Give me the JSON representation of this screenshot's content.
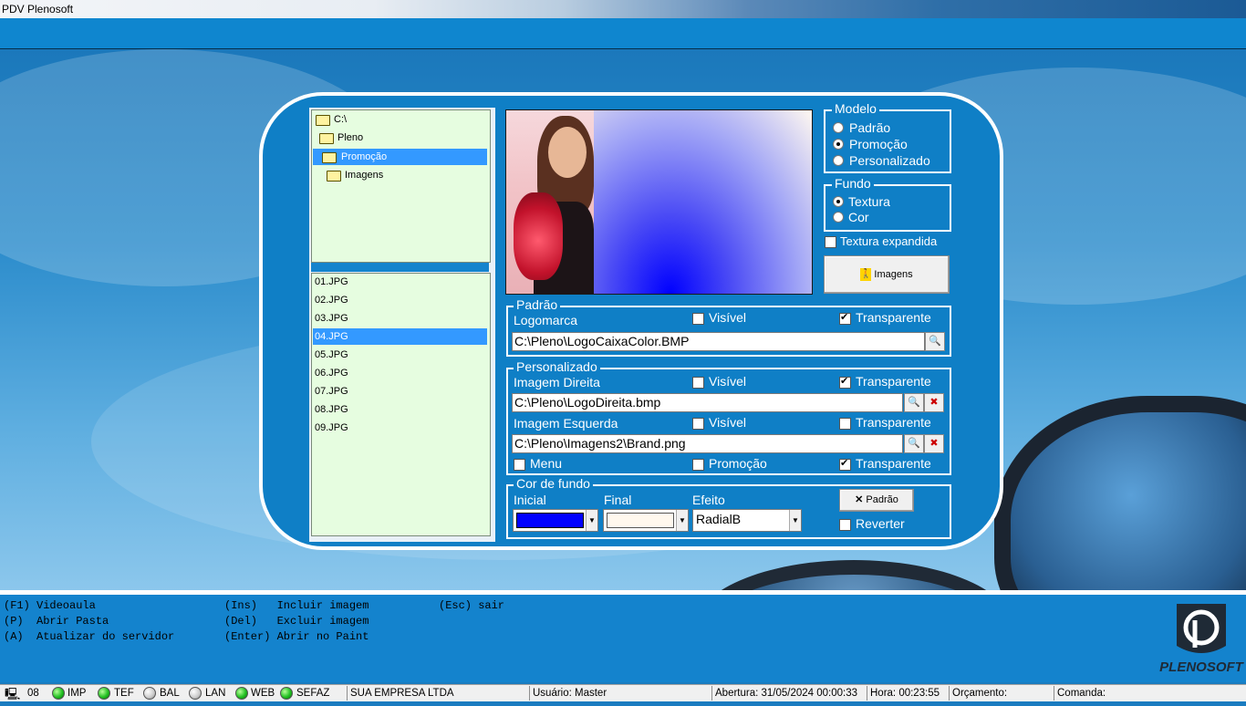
{
  "window": {
    "title": "PDV Plenosoft"
  },
  "tree": {
    "folders": [
      {
        "label": "C:\\"
      },
      {
        "label": "Pleno"
      },
      {
        "label": "Promoção"
      },
      {
        "label": "Imagens"
      }
    ],
    "files": [
      "01.JPG",
      "02.JPG",
      "03.JPG",
      "04.JPG",
      "05.JPG",
      "06.JPG",
      "07.JPG",
      "08.JPG",
      "09.JPG"
    ],
    "selected_folder": "Promoção",
    "selected_file": "04.JPG"
  },
  "modelo": {
    "title": "Modelo",
    "options": [
      "Padrão",
      "Promoção",
      "Personalizado"
    ],
    "selected": "Promoção"
  },
  "fundo": {
    "title": "Fundo",
    "options": [
      "Textura",
      "Cor"
    ],
    "selected": "Textura"
  },
  "textura_expandida": {
    "label": "Textura expandida",
    "checked": false
  },
  "imagens_button": {
    "label": "Imagens"
  },
  "padrao": {
    "title": "Padrão",
    "logomarca_label": "Logomarca",
    "visivel_label": "Visível",
    "visivel_checked": false,
    "transparente_label": "Transparente",
    "transparente_checked": true,
    "path": "C:\\Pleno\\LogoCaixaColor.BMP"
  },
  "personalizado": {
    "title": "Personalizado",
    "direita_label": "Imagem Direita",
    "direita_visivel_label": "Visível",
    "direita_visivel_checked": false,
    "direita_transparente_label": "Transparente",
    "direita_transparente_checked": true,
    "direita_path": "C:\\Pleno\\LogoDireita.bmp",
    "esquerda_label": "Imagem Esquerda",
    "esquerda_visivel_label": "Visível",
    "esquerda_visivel_checked": false,
    "esquerda_transparente_label": "Transparente",
    "esquerda_transparente_checked": false,
    "esquerda_path": "C:\\Pleno\\Imagens2\\Brand.png",
    "menu_label": "Menu",
    "menu_checked": false,
    "promocao_label": "Promoção",
    "promocao_checked": false,
    "transparente_label": "Transparente",
    "transparente_checked": true
  },
  "cor_fundo": {
    "title": "Cor de fundo",
    "inicial_label": "Inicial",
    "inicial_color": "#0000ff",
    "final_label": "Final",
    "final_color": "#fff8ee",
    "efeito_label": "Efeito",
    "efeito_value": "RadialB",
    "padrao_button": "Padrão",
    "reverter_label": "Reverter",
    "reverter_checked": false
  },
  "help": {
    "col1": [
      "(F1) Videoaula",
      "(P)  Abrir Pasta",
      "(A)  Atualizar do servidor"
    ],
    "col2": [
      "(Ins)   Incluir imagem",
      "(Del)   Excluir imagem",
      "(Enter) Abrir no Paint"
    ],
    "col3": [
      "(Esc) sair"
    ]
  },
  "brand": {
    "name": "PLENOSOFT"
  },
  "status": {
    "terminal": "08",
    "indicators": [
      {
        "label": "IMP",
        "on": true
      },
      {
        "label": "TEF",
        "on": true
      },
      {
        "label": "BAL",
        "on": false
      },
      {
        "label": "LAN",
        "on": false
      },
      {
        "label": "WEB",
        "on": true
      },
      {
        "label": "SEFAZ",
        "on": true
      }
    ],
    "company": "SUA EMPRESA LTDA",
    "usuario": "Usuário: Master",
    "abertura": "Abertura: 31/05/2024 00:00:33",
    "hora": "Hora: 00:23:55",
    "orcamento": "Orçamento:",
    "comanda": "Comanda:"
  }
}
